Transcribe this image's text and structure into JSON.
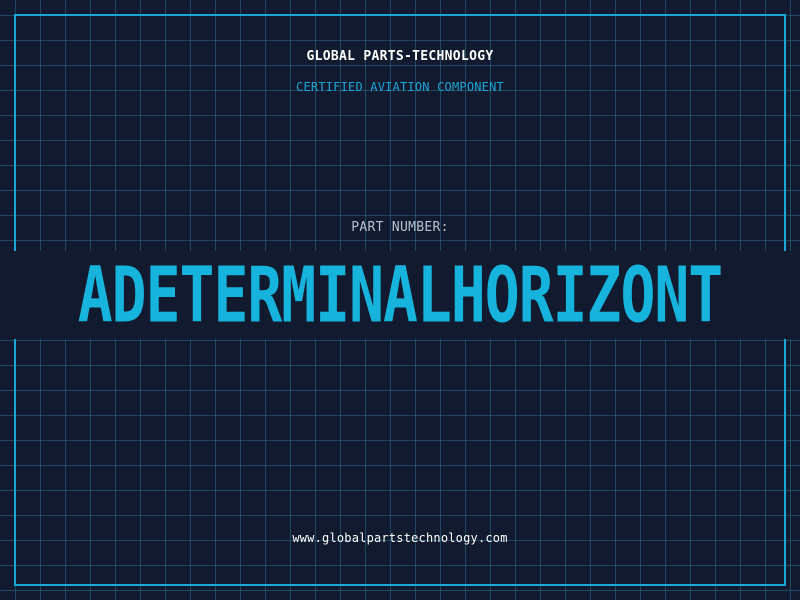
{
  "header": {
    "company_name": "GLOBAL PARTS-TECHNOLOGY",
    "subtitle": "CERTIFIED AVIATION COMPONENT"
  },
  "part": {
    "label": "PART NUMBER:",
    "number": "ADETERMINALHORIZONT"
  },
  "footer": {
    "website": "www.globalpartstechnology.com"
  },
  "colors": {
    "background": "#111a2e",
    "accent": "#1aa6d6",
    "grid": "#286e8c",
    "text": "#ffffff",
    "label": "#b8c2d0"
  }
}
